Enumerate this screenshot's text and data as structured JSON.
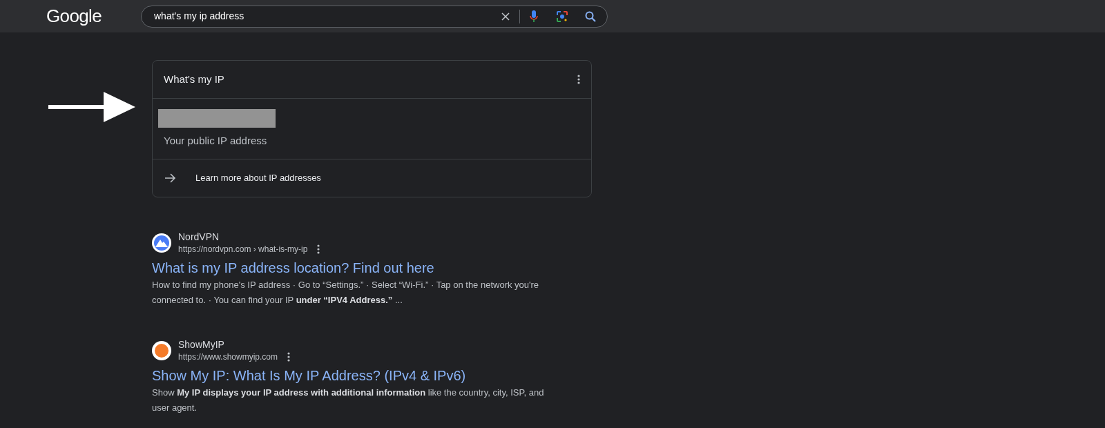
{
  "header": {
    "logo": "Google",
    "search": {
      "value": "what's my ip address"
    }
  },
  "ip_card": {
    "title": "What's my IP",
    "caption": "Your public IP address",
    "link": "Learn more about IP addresses"
  },
  "results": [
    {
      "kind": "mountain",
      "site": "NordVPN",
      "url": "https://nordvpn.com › what-is-my-ip",
      "title": "What is my IP address location? Find out here",
      "snippet": "How to find my phone's IP address · Go to “Settings.” · Select “Wi-Fi.” · Tap on the network you're connected to. · You can find your IP **under “IPV4 Address.”** ..."
    },
    {
      "kind": "dot",
      "site": "ShowMyIP",
      "url": "https://www.showmyip.com",
      "title": "Show My IP: What Is My IP Address? (IPv4 & IPv6)",
      "snippet": "Show **My IP displays your IP address with additional information** like the country, city, ISP, and user agent."
    }
  ]
}
